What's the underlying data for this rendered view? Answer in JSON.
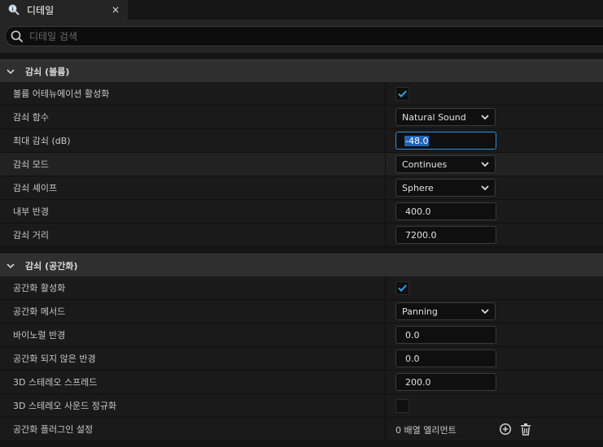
{
  "tab": {
    "title": "디테일",
    "close": "×",
    "icon": "details-search-icon"
  },
  "search": {
    "placeholder": "디테일 검색",
    "icon": "search-icon"
  },
  "colors": {
    "accent": "#2e8ed8",
    "check": "#29a3e0",
    "background": "#151515"
  },
  "sections": [
    {
      "title": "감쇠 (볼륨)",
      "rows": [
        {
          "label": "볼륨 어테뉴에이션 활성화",
          "type": "checkbox",
          "checked": true
        },
        {
          "label": "감쇠 함수",
          "type": "combo",
          "value": "Natural Sound"
        },
        {
          "label": "최대 감쇠 (dB)",
          "type": "number",
          "value": "-48.0",
          "focused": true
        },
        {
          "label": "감쇠 모드",
          "type": "combo",
          "value": "Continues"
        },
        {
          "label": "감쇠 셰이프",
          "type": "combo",
          "value": "Sphere"
        },
        {
          "label": "내부 반경",
          "type": "number",
          "value": "400.0"
        },
        {
          "label": "감쇠 거리",
          "type": "number",
          "value": "7200.0"
        }
      ]
    },
    {
      "title": "감쇠 (공간화)",
      "rows": [
        {
          "label": "공간화 활성화",
          "type": "checkbox",
          "checked": true
        },
        {
          "label": "공간화 메서드",
          "type": "combo",
          "value": "Panning"
        },
        {
          "label": "바이노럴 반경",
          "type": "number",
          "value": "0.0"
        },
        {
          "label": "공간화 되지 않은 반경",
          "type": "number",
          "value": "0.0"
        },
        {
          "label": "3D 스테레오 스프레드",
          "type": "number",
          "value": "200.0"
        },
        {
          "label": "3D 스테레오 사운드 정규화",
          "type": "checkbox",
          "checked": false
        },
        {
          "label": "공간화 플러그인 설정",
          "type": "array",
          "value": "0 배열 엘리먼트"
        }
      ]
    }
  ]
}
